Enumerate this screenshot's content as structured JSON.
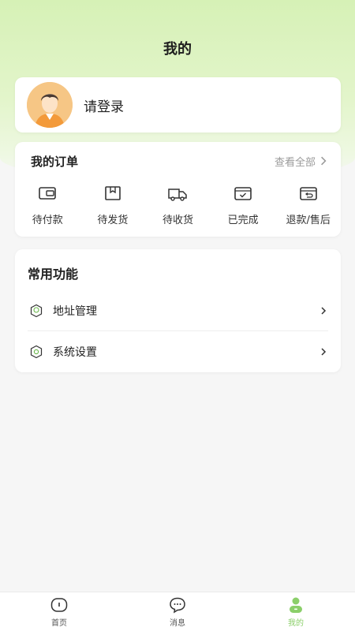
{
  "header": {
    "title": "我的"
  },
  "login": {
    "text": "请登录",
    "avatar_icon": "user-avatar-icon"
  },
  "orders": {
    "title": "我的订单",
    "view_all": "查看全部",
    "items": [
      {
        "label": "待付款",
        "icon": "wallet-icon"
      },
      {
        "label": "待发货",
        "icon": "box-icon"
      },
      {
        "label": "待收货",
        "icon": "truck-icon"
      },
      {
        "label": "已完成",
        "icon": "check-bag-icon"
      },
      {
        "label": "退款/售后",
        "icon": "refund-icon"
      }
    ]
  },
  "functions": {
    "title": "常用功能",
    "items": [
      {
        "label": "地址管理",
        "icon": "location-icon"
      },
      {
        "label": "系统设置",
        "icon": "settings-icon"
      }
    ]
  },
  "tabbar": {
    "items": [
      {
        "label": "首页",
        "icon": "home-icon"
      },
      {
        "label": "消息",
        "icon": "message-icon"
      },
      {
        "label": "我的",
        "icon": "profile-icon",
        "active": true
      }
    ]
  },
  "colors": {
    "accent": "#8bcf6a",
    "hero": "#dcf3c2"
  }
}
